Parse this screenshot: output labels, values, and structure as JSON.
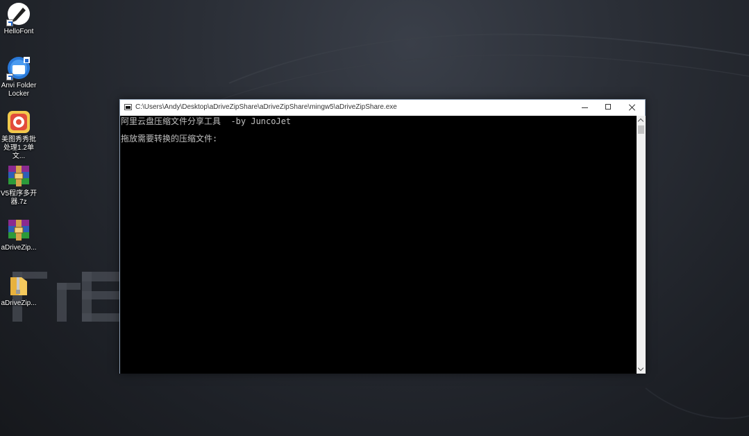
{
  "desktop": {
    "icons": [
      {
        "label": "HelloFont",
        "icon": "pen-app-icon"
      },
      {
        "label": "Anvi Folder Locker",
        "icon": "folder-lock-icon"
      },
      {
        "label": "美图秀秀批处理1.2单文...",
        "icon": "photo-batch-icon"
      },
      {
        "label": "V5程序多开器.7z",
        "icon": "winrar-archive-icon"
      },
      {
        "label": "aDriveZip...",
        "icon": "winrar-archive-icon"
      },
      {
        "label": "aDriveZip...",
        "icon": "zip-folder-icon"
      }
    ]
  },
  "console": {
    "title": "C:\\Users\\Andy\\Desktop\\aDriveZipShare\\aDriveZipShare\\mingw5\\aDriveZipShare.exe",
    "lines": [
      "阿里云盘压缩文件分享工具  -by JuncoJet",
      "拖放需要转换的压缩文件:"
    ]
  },
  "colors": {
    "console_bg": "#000000",
    "console_text": "#c0c0c0",
    "desktop_bg": "#2b2f37"
  }
}
